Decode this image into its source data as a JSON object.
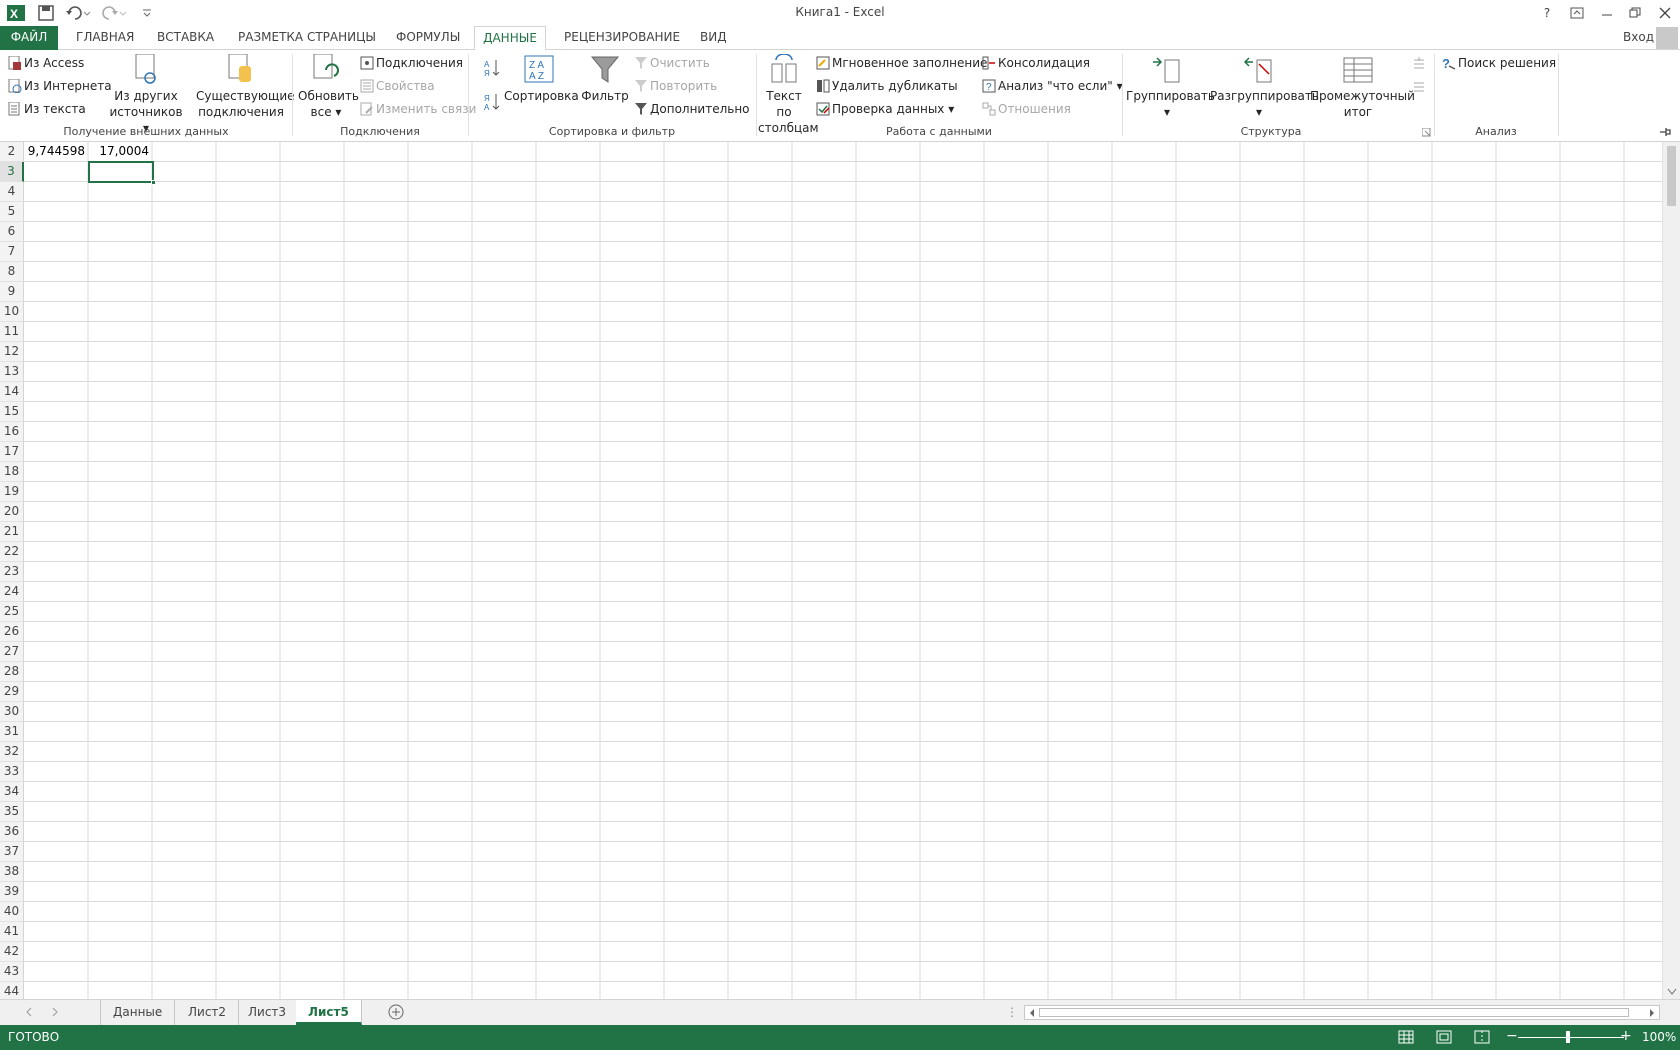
{
  "window": {
    "title": "Книга1 - Excel",
    "login": "Вход",
    "help": "?",
    "accent": "#217346"
  },
  "tabs": [
    {
      "label": "ФАЙЛ"
    },
    {
      "label": "ГЛАВНАЯ"
    },
    {
      "label": "ВСТАВКА"
    },
    {
      "label": "РАЗМЕТКА СТРАНИЦЫ"
    },
    {
      "label": "ФОРМУЛЫ"
    },
    {
      "label": "ДАННЫЕ"
    },
    {
      "label": "РЕЦЕНЗИРОВАНИЕ"
    },
    {
      "label": "ВИД"
    }
  ],
  "ribbon": {
    "external": {
      "from_access": "Из Access",
      "from_web": "Из Интернета",
      "from_text": "Из текста",
      "from_other_1": "Из других",
      "from_other_2": "источников",
      "existing_1": "Существующие",
      "existing_2": "подключения",
      "label": "Получение внешних данных"
    },
    "connections": {
      "refresh_1": "Обновить",
      "refresh_2": "все",
      "connections": "Подключения",
      "properties": "Свойства",
      "edit_links": "Изменить связи",
      "label": "Подключения"
    },
    "sort": {
      "sort": "Сортировка",
      "filter": "Фильтр",
      "clear": "Очистить",
      "reapply": "Повторить",
      "advanced": "Дополнительно",
      "label": "Сортировка и фильтр"
    },
    "datatools": {
      "text_to_cols_1": "Текст по",
      "text_to_cols_2": "столбцам",
      "flash_fill": "Мгновенное заполнение",
      "remove_dup": "Удалить дубликаты",
      "validation": "Проверка данных",
      "consolidate": "Консолидация",
      "whatif": "Анализ \"что если\"",
      "relationships": "Отношения",
      "label": "Работа с данными"
    },
    "outline": {
      "group": "Группировать",
      "ungroup": "Разгруппировать",
      "subtotal_1": "Промежуточный",
      "subtotal_2": "итог",
      "label": "Структура"
    },
    "analysis": {
      "solver": "Поиск решения",
      "label": "Анализ"
    }
  },
  "sheet": {
    "rows": [
      "2",
      "3",
      "4",
      "5",
      "6",
      "7",
      "8",
      "9",
      "10",
      "11",
      "12",
      "13",
      "14",
      "15",
      "16",
      "17",
      "18",
      "19",
      "20",
      "21",
      "22",
      "23",
      "24",
      "25",
      "26",
      "27",
      "28",
      "29",
      "30",
      "31",
      "32",
      "33",
      "34",
      "35",
      "36",
      "37",
      "38",
      "39",
      "40",
      "41",
      "42",
      "43",
      "44"
    ],
    "selected_row": "3",
    "cells": {
      "a2": "9,744598",
      "b2": "17,0004"
    }
  },
  "sheet_tabs": [
    {
      "label": "Данные"
    },
    {
      "label": "Лист2"
    },
    {
      "label": "Лист3"
    },
    {
      "label": "Лист5"
    }
  ],
  "status": {
    "ready": "ГОТОВО",
    "zoom": "100%"
  }
}
